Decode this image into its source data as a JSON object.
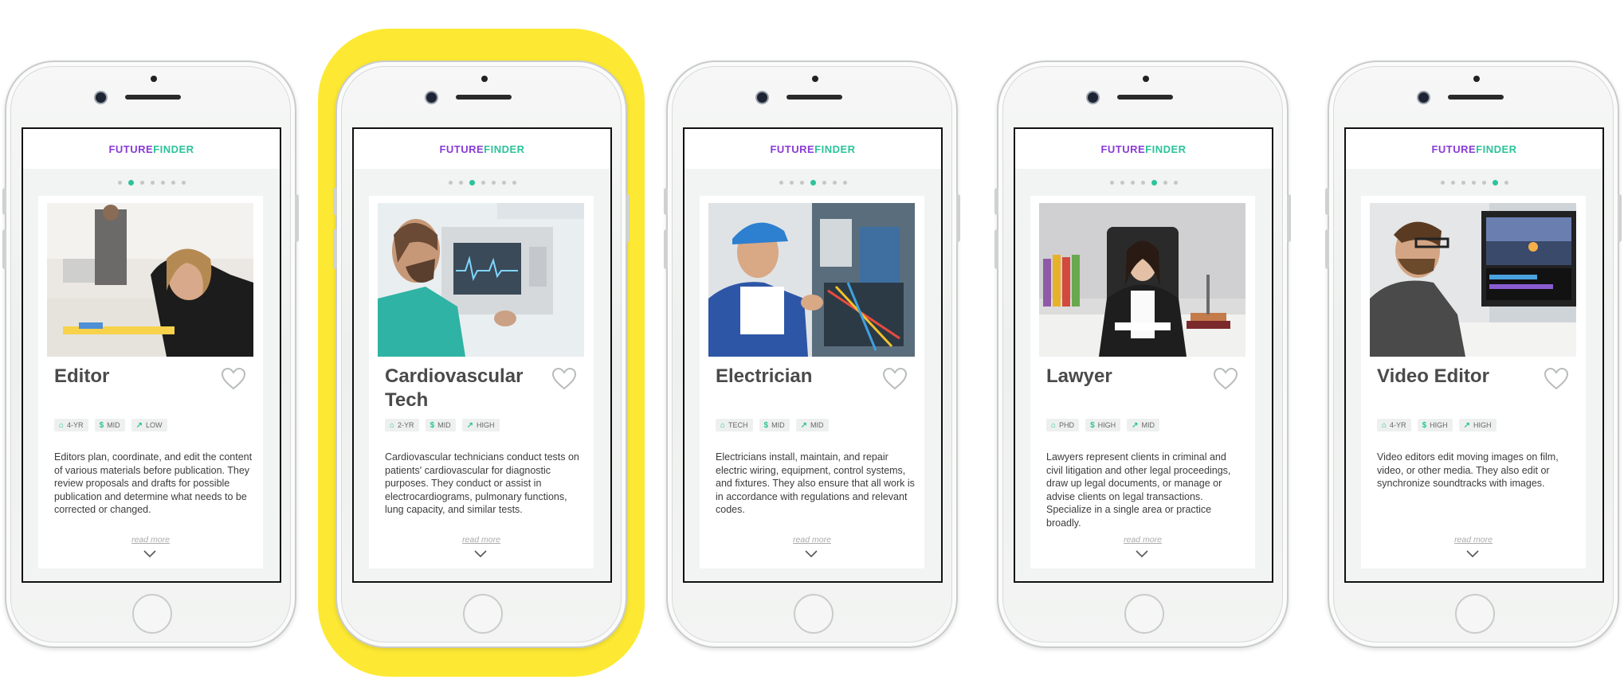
{
  "brand": {
    "part1": "FUTURE",
    "part2": "FINDER"
  },
  "read_more_label": "read more",
  "colors": {
    "highlight": "#fde933",
    "accent_green": "#2bc39a",
    "accent_purple": "#8a3bd6"
  },
  "icons": {
    "education": "graduation-cap-icon",
    "salary": "dollar-icon",
    "growth": "trend-up-icon",
    "favorite": "heart-icon",
    "expand": "chevron-down-icon"
  },
  "phones": [
    {
      "title": "Editor",
      "pagination_active_index": 1,
      "pagination_total": 7,
      "tags": [
        {
          "icon": "graduation-cap",
          "text": "4-YR"
        },
        {
          "icon": "dollar",
          "text": "MID"
        },
        {
          "icon": "trend",
          "text": "LOW"
        }
      ],
      "description": "Editors plan, coordinate, and edit the content of various materials before publication. They review proposals and drafts for possible publication and determine what needs to be corrected or changed."
    },
    {
      "title": "Cardiovascular Tech",
      "pagination_active_index": 2,
      "pagination_total": 7,
      "tags": [
        {
          "icon": "graduation-cap",
          "text": "2-YR"
        },
        {
          "icon": "dollar",
          "text": "MID"
        },
        {
          "icon": "trend",
          "text": "HIGH"
        }
      ],
      "description": "Cardiovascular technicians conduct tests on patients' cardiovascular for diagnostic purposes. They conduct or assist in electrocardiograms, pulmonary functions, lung capacity, and similar tests."
    },
    {
      "title": "Electrician",
      "pagination_active_index": 3,
      "pagination_total": 7,
      "tags": [
        {
          "icon": "graduation-cap",
          "text": "TECH"
        },
        {
          "icon": "dollar",
          "text": "MID"
        },
        {
          "icon": "trend",
          "text": "MID"
        }
      ],
      "description": "Electricians install, maintain, and repair electric wiring, equipment, control systems, and fixtures. They also ensure that all work is in accordance with regulations and relevant codes."
    },
    {
      "title": "Lawyer",
      "pagination_active_index": 4,
      "pagination_total": 7,
      "tags": [
        {
          "icon": "graduation-cap",
          "text": "PHD"
        },
        {
          "icon": "dollar",
          "text": "HIGH"
        },
        {
          "icon": "trend",
          "text": "MID"
        }
      ],
      "description": "Lawyers represent clients in criminal and civil litigation and other legal proceedings, draw up legal documents, or manage or advise clients on legal transactions. Specialize in a single area or practice broadly."
    },
    {
      "title": "Video Editor",
      "pagination_active_index": 5,
      "pagination_total": 7,
      "tags": [
        {
          "icon": "graduation-cap",
          "text": "4-YR"
        },
        {
          "icon": "dollar",
          "text": "HIGH"
        },
        {
          "icon": "trend",
          "text": "HIGH"
        }
      ],
      "description": "Video editors edit moving images on film, video, or other media. They also edit or synchronize soundtracks with images."
    }
  ]
}
